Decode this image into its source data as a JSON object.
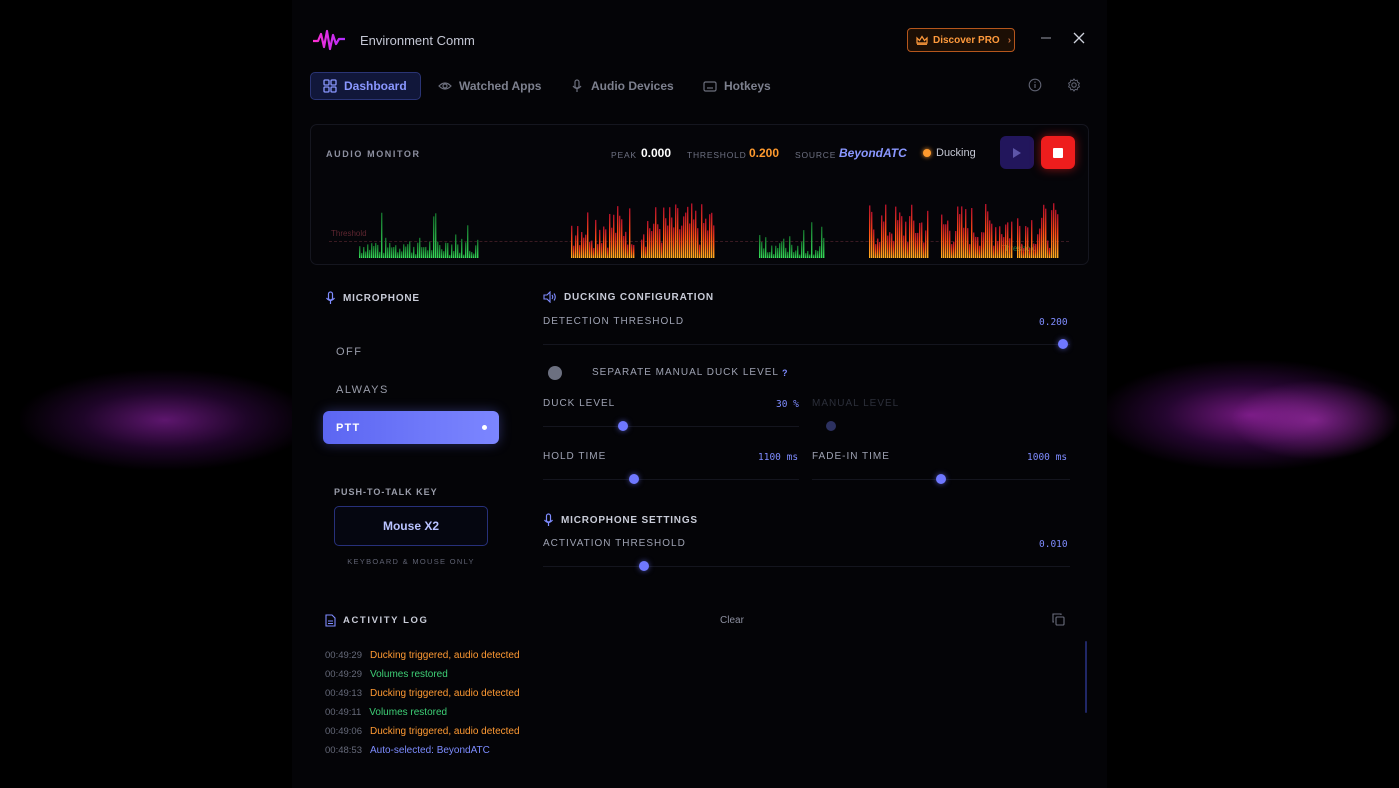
{
  "app": {
    "title": "Environment Comm",
    "pro_label": "Discover PRO",
    "pro_chevron": "›"
  },
  "tabs": [
    {
      "label": "Dashboard",
      "icon": "grid-icon",
      "active": true
    },
    {
      "label": "Watched Apps",
      "icon": "eye-icon"
    },
    {
      "label": "Audio Devices",
      "icon": "microphone-icon"
    },
    {
      "label": "Hotkeys",
      "icon": "keyboard-icon"
    }
  ],
  "monitor": {
    "title": "AUDIO MONITOR",
    "peak_label": "PEAK",
    "peak_value": "0.000",
    "threshold_label": "THRESHOLD",
    "threshold_value": "0.200",
    "source_label": "SOURCE",
    "source_value": "BeyondATC",
    "status": "Ducking",
    "threshold_marker": "Threshold",
    "threshold_marker_right": "Threshold",
    "colors": {
      "duck_bars": "#ff5a1e",
      "idle_bars": "#28c84a",
      "status_dot": "#ff9a2e",
      "stop": "#ee1d1d"
    }
  },
  "microphone": {
    "title": "MICROPHONE",
    "modes": [
      "OFF",
      "ALWAYS",
      "PTT"
    ],
    "selected_mode": "PTT",
    "ptt_key_label": "PUSH-TO-TALK KEY",
    "ptt_key_value": "Mouse X2",
    "ptt_hint": "KEYBOARD & MOUSE ONLY"
  },
  "ducking": {
    "title": "DUCKING CONFIGURATION",
    "detection_label": "DETECTION THRESHOLD",
    "detection_value": "0.200",
    "separate_label": "SEPARATE MANUAL DUCK LEVEL",
    "separate_help": "?",
    "duck_level_label": "DUCK LEVEL",
    "duck_level_value": "30 %",
    "manual_level_label": "MANUAL LEVEL",
    "hold_label": "HOLD TIME",
    "hold_value": "1100 ms",
    "fadein_label": "FADE-IN TIME",
    "fadein_value": "1000 ms"
  },
  "mic_settings": {
    "title": "MICROPHONE SETTINGS",
    "activation_label": "ACTIVATION THRESHOLD",
    "activation_value": "0.010"
  },
  "log": {
    "title": "ACTIVITY LOG",
    "clear_label": "Clear",
    "entries": [
      {
        "time": "00:49:29",
        "text": "Ducking triggered, audio detected",
        "kind": "duck"
      },
      {
        "time": "00:49:29",
        "text": "Volumes restored",
        "kind": "restore"
      },
      {
        "time": "00:49:13",
        "text": "Ducking triggered, audio detected",
        "kind": "duck"
      },
      {
        "time": "00:49:11",
        "text": "Volumes restored",
        "kind": "restore"
      },
      {
        "time": "00:49:06",
        "text": "Ducking triggered, audio detected",
        "kind": "duck"
      },
      {
        "time": "00:48:53",
        "text": "Auto-selected: BeyondATC",
        "kind": "info"
      }
    ]
  }
}
